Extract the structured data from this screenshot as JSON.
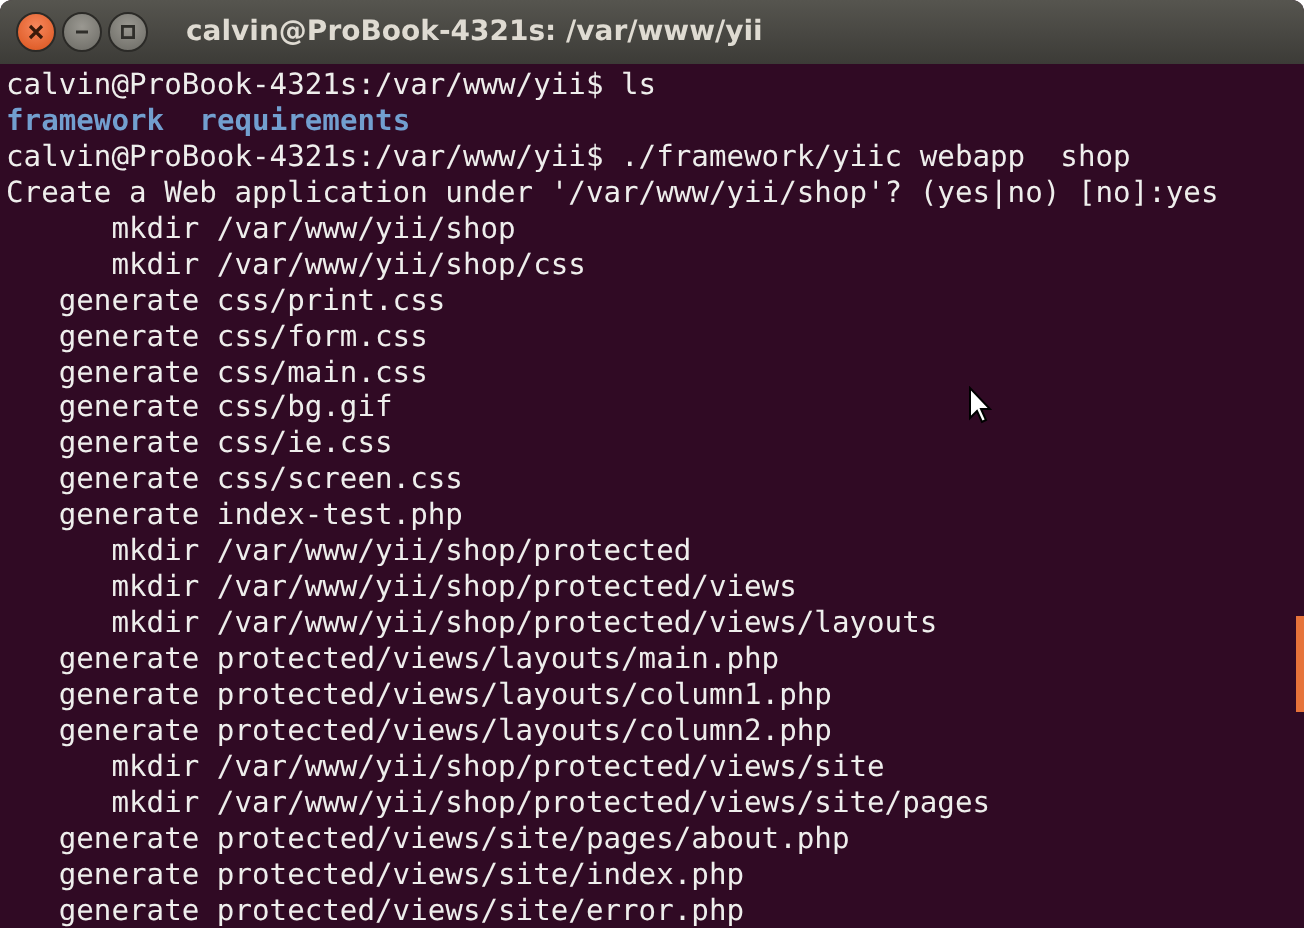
{
  "window": {
    "title": "calvin@ProBook-4321s: /var/www/yii"
  },
  "terminal": {
    "lines": [
      {
        "kind": "text",
        "text": "calvin@ProBook-4321s:/var/www/yii$ ls"
      },
      {
        "kind": "listing",
        "entries": [
          "framework",
          "requirements"
        ]
      },
      {
        "kind": "text",
        "text": "calvin@ProBook-4321s:/var/www/yii$ ./framework/yiic webapp  shop"
      },
      {
        "kind": "text",
        "text": "Create a Web application under '/var/www/yii/shop'? (yes|no) [no]:yes"
      },
      {
        "kind": "text",
        "text": "      mkdir /var/www/yii/shop"
      },
      {
        "kind": "text",
        "text": "      mkdir /var/www/yii/shop/css"
      },
      {
        "kind": "text",
        "text": "   generate css/print.css"
      },
      {
        "kind": "text",
        "text": "   generate css/form.css"
      },
      {
        "kind": "text",
        "text": "   generate css/main.css"
      },
      {
        "kind": "text",
        "text": "   generate css/bg.gif"
      },
      {
        "kind": "text",
        "text": "   generate css/ie.css"
      },
      {
        "kind": "text",
        "text": "   generate css/screen.css"
      },
      {
        "kind": "text",
        "text": "   generate index-test.php"
      },
      {
        "kind": "text",
        "text": "      mkdir /var/www/yii/shop/protected"
      },
      {
        "kind": "text",
        "text": "      mkdir /var/www/yii/shop/protected/views"
      },
      {
        "kind": "text",
        "text": "      mkdir /var/www/yii/shop/protected/views/layouts"
      },
      {
        "kind": "text",
        "text": "   generate protected/views/layouts/main.php"
      },
      {
        "kind": "text",
        "text": "   generate protected/views/layouts/column1.php"
      },
      {
        "kind": "text",
        "text": "   generate protected/views/layouts/column2.php"
      },
      {
        "kind": "text",
        "text": "      mkdir /var/www/yii/shop/protected/views/site"
      },
      {
        "kind": "text",
        "text": "      mkdir /var/www/yii/shop/protected/views/site/pages"
      },
      {
        "kind": "text",
        "text": "   generate protected/views/site/pages/about.php"
      },
      {
        "kind": "text",
        "text": "   generate protected/views/site/index.php"
      },
      {
        "kind": "text",
        "text": "   generate protected/views/site/error.php"
      }
    ]
  }
}
